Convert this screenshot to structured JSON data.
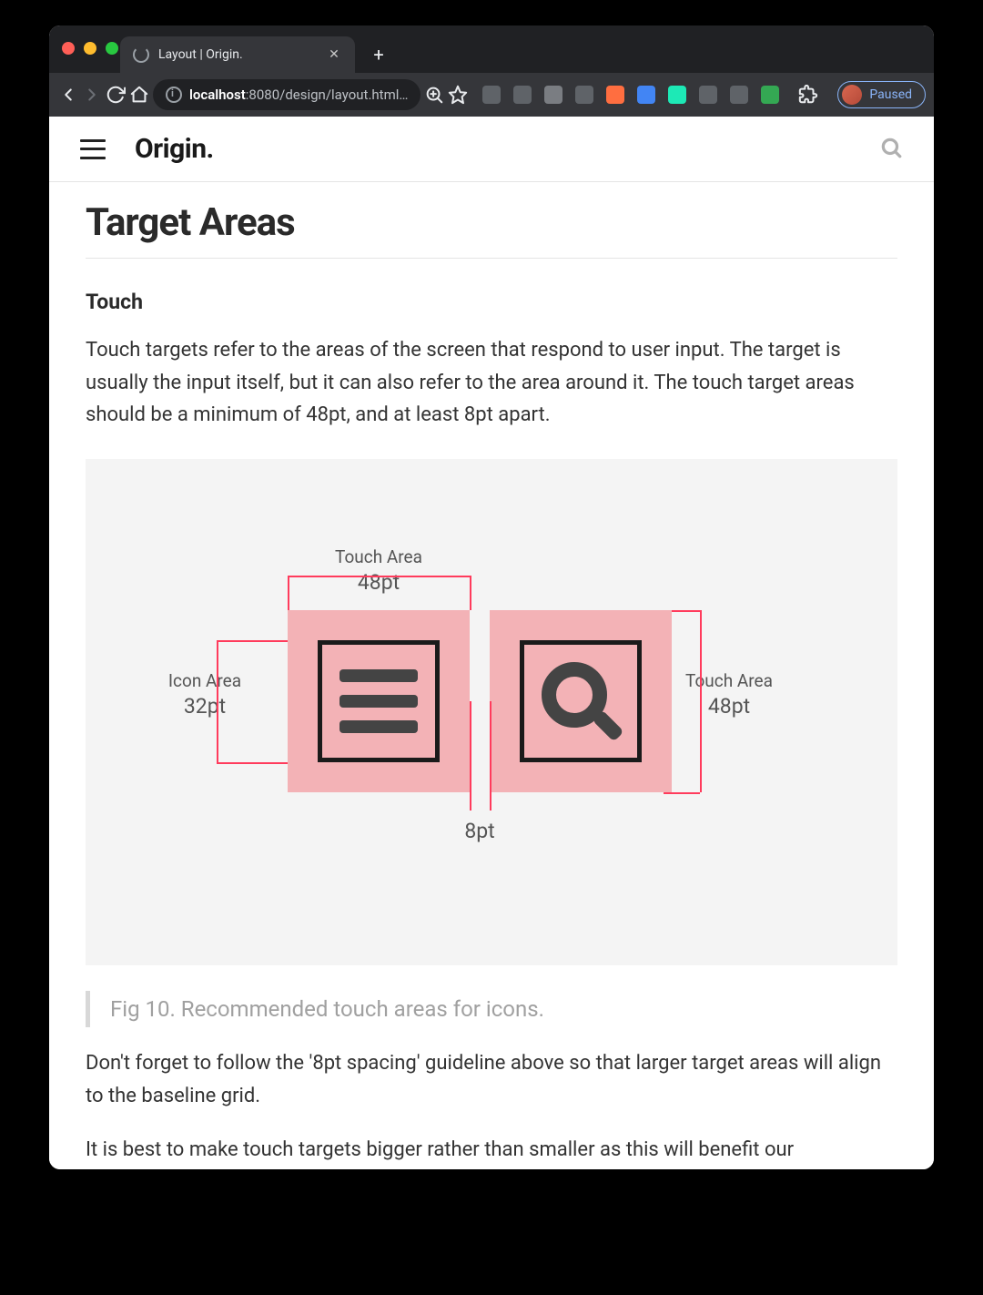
{
  "browser": {
    "tab_title": "Layout | Origin.",
    "url_host": "localhost",
    "url_port": ":8080",
    "url_path": "/design/layout.html…",
    "paused_label": "Paused"
  },
  "site": {
    "brand": "Origin."
  },
  "page": {
    "h1": "Target Areas",
    "h2": "Touch",
    "p1": "Touch targets refer to the areas of the screen that respond to user input. The target is usually the input itself, but it can also refer to the area around it. The touch target areas should be a minimum of 48pt, and at least 8pt apart.",
    "caption": "Fig 10. Recommended touch areas for icons.",
    "p2": "Don't forget to follow the '8pt spacing' guideline above so that larger target areas will align to the baseline grid.",
    "p3": "It is best to make touch targets bigger rather than smaller as this will benefit our"
  },
  "diagram": {
    "top_label_1": "Touch Area",
    "top_label_2": "48pt",
    "left_label_1": "Icon Area",
    "left_label_2": "32pt",
    "right_label_1": "Touch Area",
    "right_label_2": "48pt",
    "gap_label": "8pt"
  }
}
